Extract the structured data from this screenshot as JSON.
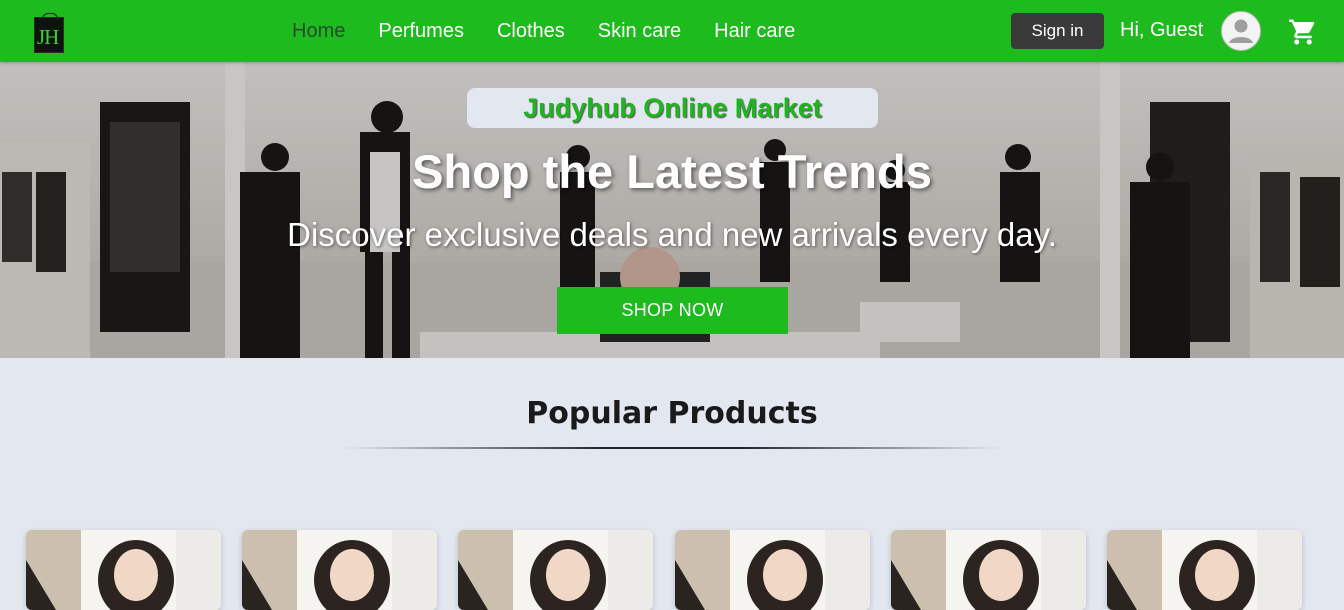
{
  "brand": {
    "logo_text": "JH"
  },
  "nav": {
    "links": [
      {
        "label": "Home",
        "active": true
      },
      {
        "label": "Perfumes",
        "active": false
      },
      {
        "label": "Clothes",
        "active": false
      },
      {
        "label": "Skin care",
        "active": false
      },
      {
        "label": "Hair care",
        "active": false
      }
    ],
    "signin_label": "Sign in",
    "greeting": "Hi, Guest",
    "avatar_icon": "user-avatar-icon",
    "cart_icon": "shopping-cart-icon"
  },
  "hero": {
    "badge": "Judyhub Online Market",
    "title": "Shop the Latest Trends",
    "subtitle": "Discover exclusive deals and new arrivals every day.",
    "cta_label": "SHOP NOW"
  },
  "popular": {
    "title": "Popular Products",
    "products": [
      {
        "image": "product-photo-woman"
      },
      {
        "image": "product-photo-woman"
      },
      {
        "image": "product-photo-woman"
      },
      {
        "image": "product-photo-woman"
      },
      {
        "image": "product-photo-woman"
      },
      {
        "image": "product-photo-woman"
      }
    ]
  },
  "colors": {
    "primary_green": "#1dbb1d",
    "page_bg": "#e3e8f0",
    "signin_bg": "#3a3a3a"
  }
}
